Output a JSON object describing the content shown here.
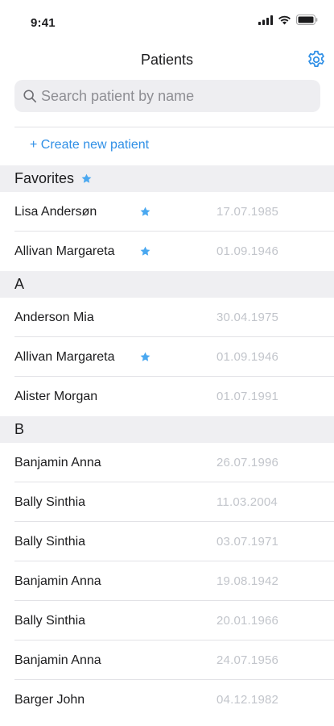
{
  "status_bar": {
    "time": "9:41"
  },
  "nav": {
    "title": "Patients"
  },
  "search": {
    "placeholder": "Search patient by name",
    "value": ""
  },
  "create_link": "+ Create new patient",
  "accent_color": "#2f8fe6",
  "star_color": "#4aa8f0",
  "sections": [
    {
      "header": "Favorites",
      "header_star": true,
      "rows": [
        {
          "name": "Lisa Andersøn",
          "date": "17.07.1985",
          "favorite": true
        },
        {
          "name": "Allivan Margareta",
          "date": "01.09.1946",
          "favorite": true
        }
      ]
    },
    {
      "header": "A",
      "header_star": false,
      "rows": [
        {
          "name": "Anderson Mia",
          "date": "30.04.1975",
          "favorite": false
        },
        {
          "name": "Allivan Margareta",
          "date": "01.09.1946",
          "favorite": true
        },
        {
          "name": "Alister Morgan",
          "date": "01.07.1991",
          "favorite": false
        }
      ]
    },
    {
      "header": "B",
      "header_star": false,
      "rows": [
        {
          "name": "Banjamin Anna",
          "date": "26.07.1996",
          "favorite": false
        },
        {
          "name": "Bally Sinthia",
          "date": "11.03.2004",
          "favorite": false
        },
        {
          "name": "Bally Sinthia",
          "date": "03.07.1971",
          "favorite": false
        },
        {
          "name": "Banjamin Anna",
          "date": "19.08.1942",
          "favorite": false
        },
        {
          "name": "Bally Sinthia",
          "date": "20.01.1966",
          "favorite": false
        },
        {
          "name": "Banjamin Anna",
          "date": "24.07.1956",
          "favorite": false
        },
        {
          "name": "Barger John",
          "date": "04.12.1982",
          "favorite": false
        }
      ]
    }
  ]
}
